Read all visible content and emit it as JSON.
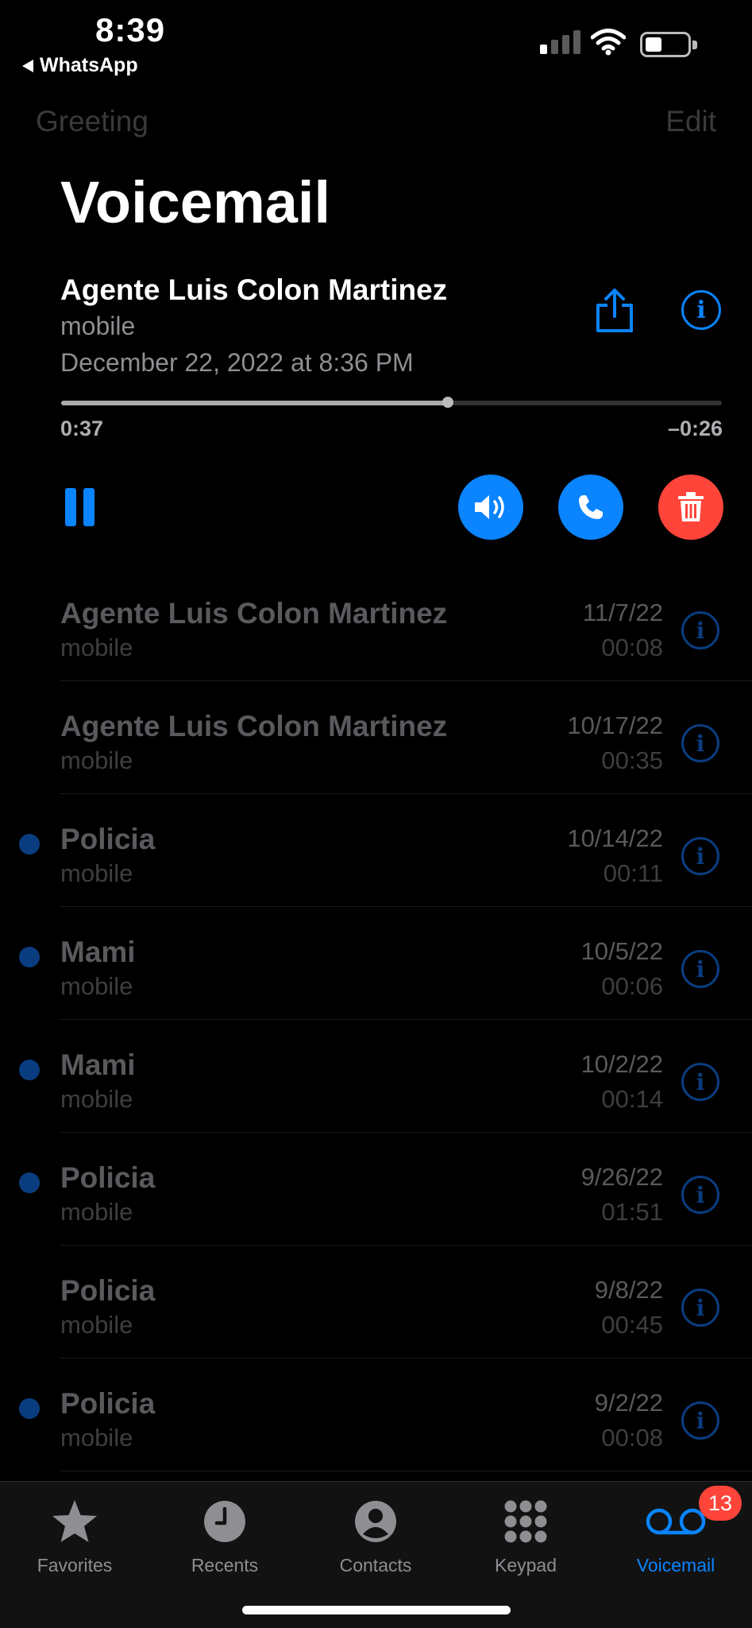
{
  "status_bar": {
    "time": "8:39",
    "back_app": "WhatsApp"
  },
  "nav": {
    "left": "Greeting",
    "right": "Edit",
    "title": "Voicemail"
  },
  "current_voicemail": {
    "name": "Agente Luis Colon Martinez",
    "type": "mobile",
    "date": "December 22, 2022 at 8:36 PM",
    "elapsed": "0:37",
    "remaining": "–0:26",
    "progress": 0.585
  },
  "voicemails": [
    {
      "name": "Agente Luis Colon Martinez",
      "type": "mobile",
      "date": "11/7/22",
      "duration": "00:08",
      "unread": false
    },
    {
      "name": "Agente Luis Colon Martinez",
      "type": "mobile",
      "date": "10/17/22",
      "duration": "00:35",
      "unread": false
    },
    {
      "name": "Policia",
      "type": "mobile",
      "date": "10/14/22",
      "duration": "00:11",
      "unread": true
    },
    {
      "name": "Mami",
      "type": "mobile",
      "date": "10/5/22",
      "duration": "00:06",
      "unread": true
    },
    {
      "name": "Mami",
      "type": "mobile",
      "date": "10/2/22",
      "duration": "00:14",
      "unread": true
    },
    {
      "name": "Policia",
      "type": "mobile",
      "date": "9/26/22",
      "duration": "01:51",
      "unread": true
    },
    {
      "name": "Policia",
      "type": "mobile",
      "date": "9/8/22",
      "duration": "00:45",
      "unread": false
    },
    {
      "name": "Policia",
      "type": "mobile",
      "date": "9/2/22",
      "duration": "00:08",
      "unread": true
    }
  ],
  "tabs": [
    {
      "label": "Favorites",
      "icon": "star-icon"
    },
    {
      "label": "Recents",
      "icon": "clock-icon"
    },
    {
      "label": "Contacts",
      "icon": "person-circle-icon"
    },
    {
      "label": "Keypad",
      "icon": "keypad-icon"
    },
    {
      "label": "Voicemail",
      "icon": "voicemail-icon",
      "active": true
    }
  ],
  "voicemail_badge": "13",
  "colors": {
    "accent": "#0a84ff",
    "delete": "#ff453a",
    "background": "#000000"
  }
}
